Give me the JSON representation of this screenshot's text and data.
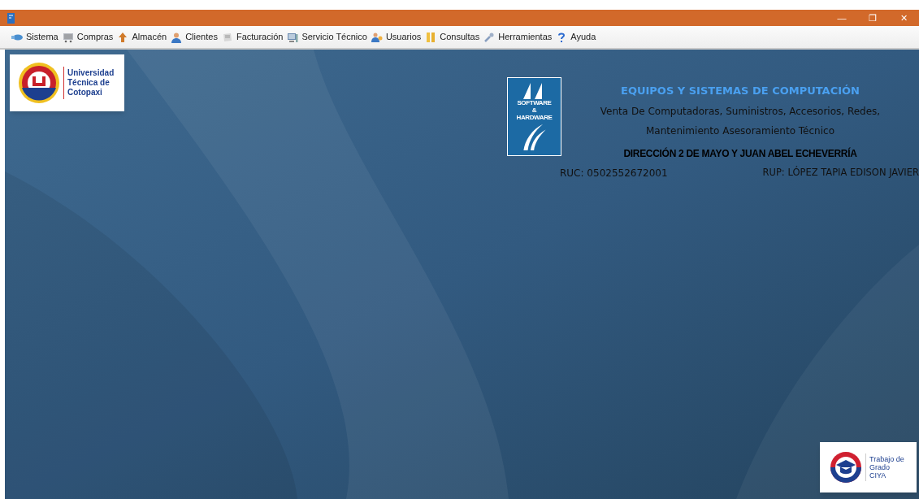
{
  "window": {
    "controls": [
      "—",
      "❐",
      "✕"
    ]
  },
  "menu": [
    {
      "label": "Sistema"
    },
    {
      "label": "Compras"
    },
    {
      "label": "Almacén"
    },
    {
      "label": "Clientes"
    },
    {
      "label": "Facturación"
    },
    {
      "label": "Servicio Técnico"
    },
    {
      "label": "Usuarios"
    },
    {
      "label": "Consultas"
    },
    {
      "label": "Herramientas"
    },
    {
      "label": "Ayuda"
    }
  ],
  "university_logo": {
    "lines": [
      "Universidad",
      "Técnica de",
      "Cotopaxi"
    ]
  },
  "company": {
    "logo_lines": [
      "SOFTWARE",
      "&",
      "HARDWARE"
    ],
    "title": "EQUIPOS Y SISTEMAS DE COMPUTACIÓN",
    "description_lines": [
      "Venta De Computadoras, Suministros, Accesorios, Redes,",
      "Mantenimiento Asesoramiento Técnico"
    ],
    "address": "DIRECCIÓN 2 DE MAYO Y JUAN ABEL ECHEVERRÍA",
    "ruc": "RUC: 0502552672001",
    "rup": "RUP: LÓPEZ TAPIA EDISON JAVIER"
  },
  "grade_logo": {
    "lines": [
      "Trabajo de",
      "Grado",
      "CIYA"
    ]
  }
}
